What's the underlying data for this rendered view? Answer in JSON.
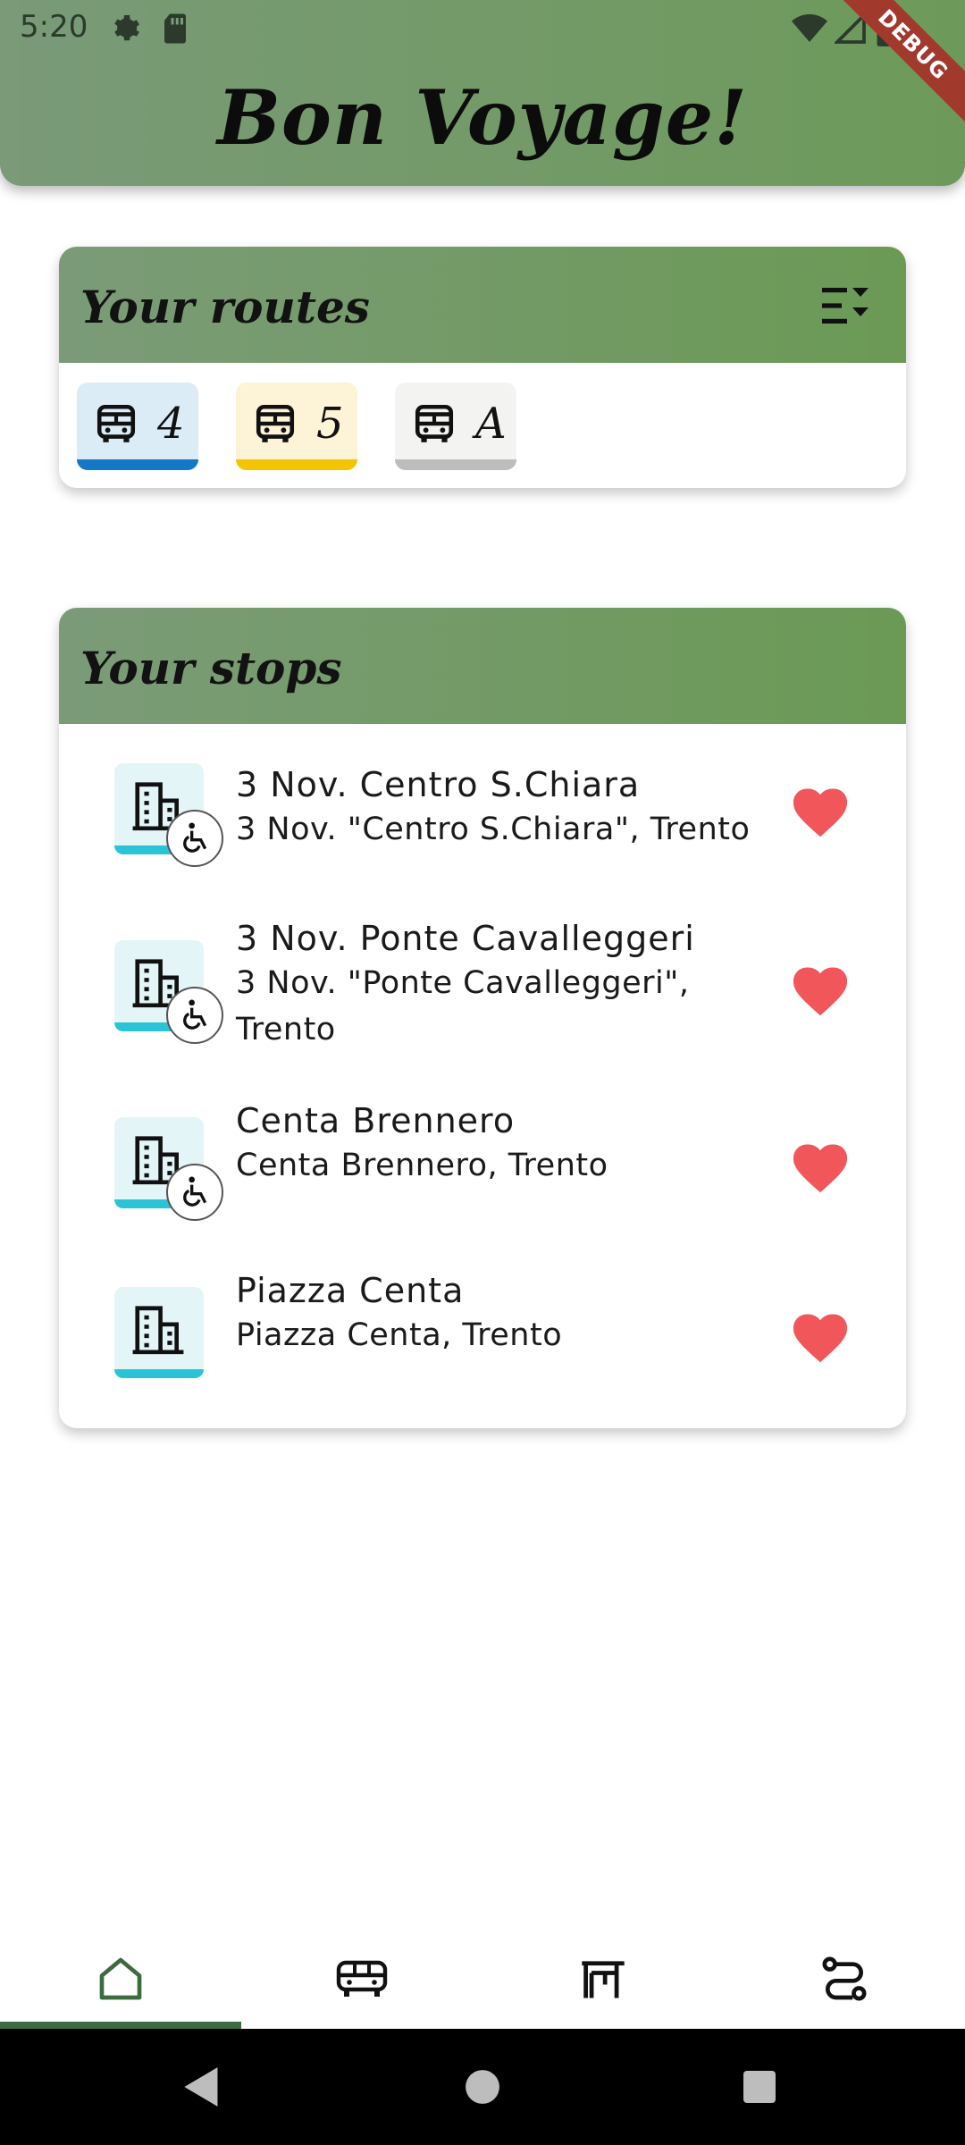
{
  "status_bar": {
    "time": "5:20",
    "icons": [
      "gear-icon",
      "sd-card-icon",
      "wifi-icon",
      "signal-icon",
      "battery-icon"
    ]
  },
  "app": {
    "title": "Bon Voyage!",
    "debug_banner": "DEBUG"
  },
  "colors": {
    "header_gradient": [
      "#7a9a78",
      "#6d9a5a"
    ],
    "heart": "#f0565a",
    "nav_indicator": "#3b6b3f",
    "stop_bar": "#2bc4d6"
  },
  "routes": {
    "title": "Your routes",
    "filter_icon": "filter-list-icon",
    "items": [
      {
        "label": "4",
        "icon": "bus-icon",
        "bg": "#dcecf6",
        "bar": "#1478c8"
      },
      {
        "label": "5",
        "icon": "bus-icon",
        "bg": "#fdf3d6",
        "bar": "#f5c400"
      },
      {
        "label": "A",
        "icon": "bus-icon",
        "bg": "#f3f3f1",
        "bar": "#bdbdbd"
      }
    ]
  },
  "stops": {
    "title": "Your stops",
    "items": [
      {
        "name": "3 Nov. Centro S.Chiara",
        "address": "3 Nov. \"Centro S.Chiara\", Trento",
        "accessible": true,
        "favorite": true
      },
      {
        "name": "3 Nov. Ponte Cavalleggeri",
        "address": "3 Nov. \"Ponte Cavalleggeri\", Trento",
        "accessible": true,
        "favorite": true
      },
      {
        "name": "Centa Brennero",
        "address": "Centa Brennero, Trento",
        "accessible": true,
        "favorite": true
      },
      {
        "name": "Piazza Centa",
        "address": "Piazza Centa, Trento",
        "accessible": false,
        "favorite": true
      }
    ]
  },
  "bottom_nav": {
    "items": [
      {
        "icon": "home-icon",
        "selected": true
      },
      {
        "icon": "bus-icon",
        "selected": false
      },
      {
        "icon": "bus-stop-icon",
        "selected": false
      },
      {
        "icon": "route-icon",
        "selected": false
      }
    ]
  },
  "system_nav": [
    "back-icon",
    "home-circle-icon",
    "recents-icon"
  ]
}
